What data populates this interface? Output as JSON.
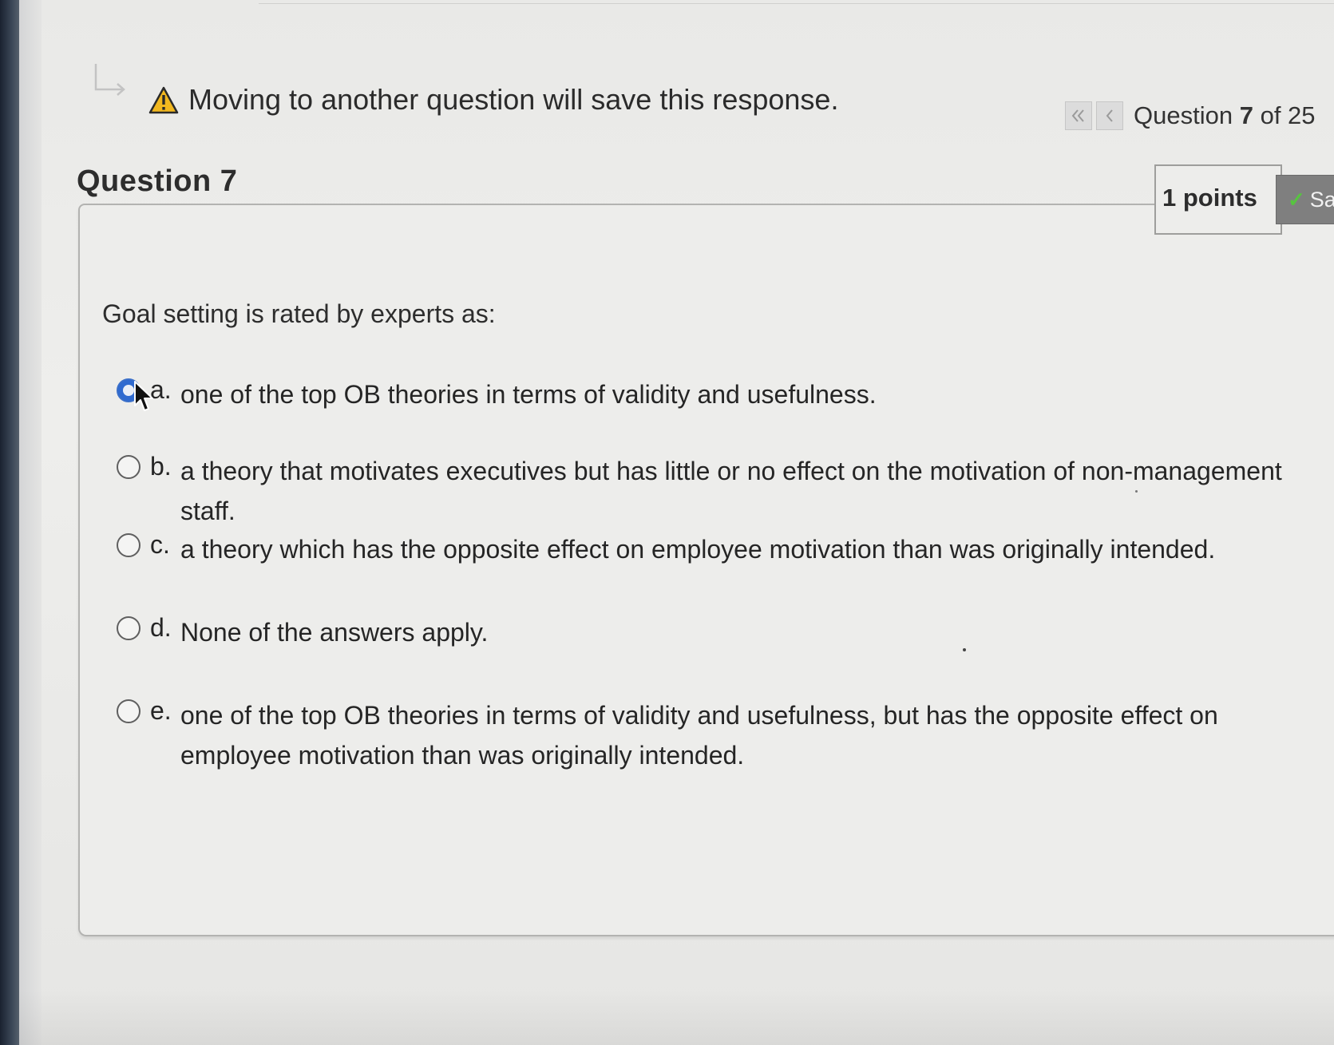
{
  "header": {
    "warning_text": "Moving to another question will save this response.",
    "nav": {
      "first_icon": "double-chevron-left-icon",
      "prev_icon": "chevron-left-icon",
      "counter_prefix": "Question",
      "counter_current": "7",
      "counter_of": "of 25"
    }
  },
  "question": {
    "title": "Question 7",
    "points": "1 points",
    "save_label": "Sa",
    "prompt": "Goal setting is rated by experts as:",
    "selected_index": 0,
    "options": [
      {
        "letter": "a.",
        "text": "one of the top OB theories in terms of validity and usefulness."
      },
      {
        "letter": "b.",
        "text": "a theory that motivates executives but has little or no effect on the motivation of non-management staff."
      },
      {
        "letter": "c.",
        "text": "a theory which has the opposite effect on employee motivation than was originally intended."
      },
      {
        "letter": "d.",
        "text": "None of the answers apply."
      },
      {
        "letter": "e.",
        "text": "one of the top OB theories in terms of validity and usefulness, but has the opposite effect on employee motivation than was originally intended."
      }
    ]
  },
  "colors": {
    "selected_radio": "#2f6ad0",
    "save_check": "#57c440",
    "save_bg": "#7f7f7f"
  }
}
